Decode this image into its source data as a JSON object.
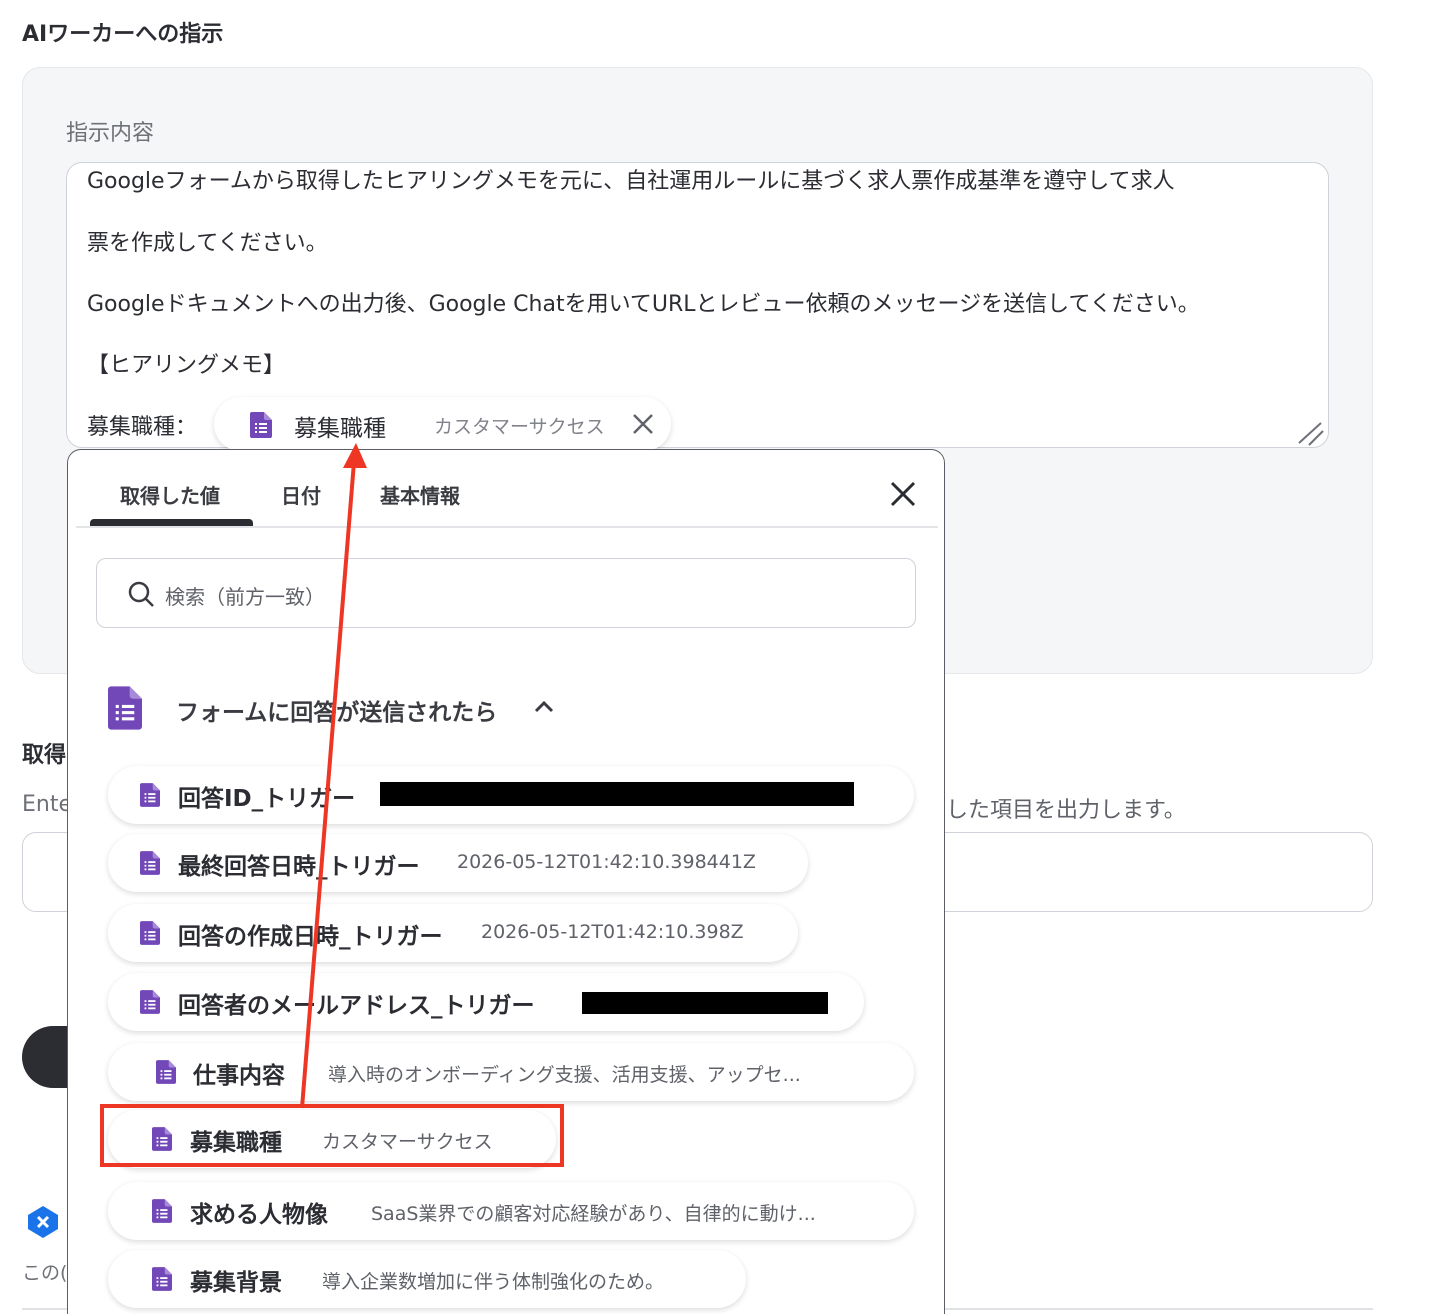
{
  "section_title": "AIワーカーへの指示",
  "instruction": {
    "label": "指示内容",
    "lines": [
      "Googleフォームから取得したヒアリングメモを元に、自社運用ルールに基づく求人票作成基準を遵守して求人",
      "票を作成してください。",
      "Googleドキュメントへの出力後、Google Chatを用いてURLとレビュー依頼のメッセージを送信してください。",
      "【ヒアリングメモ】",
      "募集職種："
    ],
    "chip": {
      "name": "募集職種",
      "value": "カスタマーサクセス"
    }
  },
  "background": {
    "label_partial": "取得",
    "desc_partial_left": "Ente",
    "desc_partial_right": "した項目を出力します。",
    "note_partial": "この("
  },
  "popup": {
    "tabs": [
      "取得した値",
      "日付",
      "基本情報"
    ],
    "active_tab": "取得した値",
    "search_placeholder": "検索（前方一致）",
    "group_label": "フォームに回答が送信されたら",
    "items": [
      {
        "name": "回答ID_トリガー",
        "value": ""
      },
      {
        "name": "最終回答日時_トリガー",
        "value": "2026-05-12T01:42:10.398441Z"
      },
      {
        "name": "回答の作成日時_トリガー",
        "value": "2026-05-12T01:42:10.398Z"
      },
      {
        "name": "回答者のメールアドレス_トリガー",
        "value": ""
      },
      {
        "name": "仕事内容",
        "value": "導入時のオンボーディング支援、活用支援、アップセ..."
      },
      {
        "name": "募集職種",
        "value": "カスタマーサクセス"
      },
      {
        "name": "求める人物像",
        "value": "SaaS業界での顧客対応経験があり、自律的に動け..."
      },
      {
        "name": "募集背景",
        "value": "導入企業数増加に伴う体制強化のため。"
      }
    ]
  },
  "colors": {
    "accent_purple": "#7248b9",
    "annotation_red": "#ee3624",
    "dark": "#2b2d33"
  },
  "icons": [
    "google-forms-icon",
    "close-icon",
    "search-icon",
    "chevron-up-icon",
    "resize-handle-icon"
  ]
}
